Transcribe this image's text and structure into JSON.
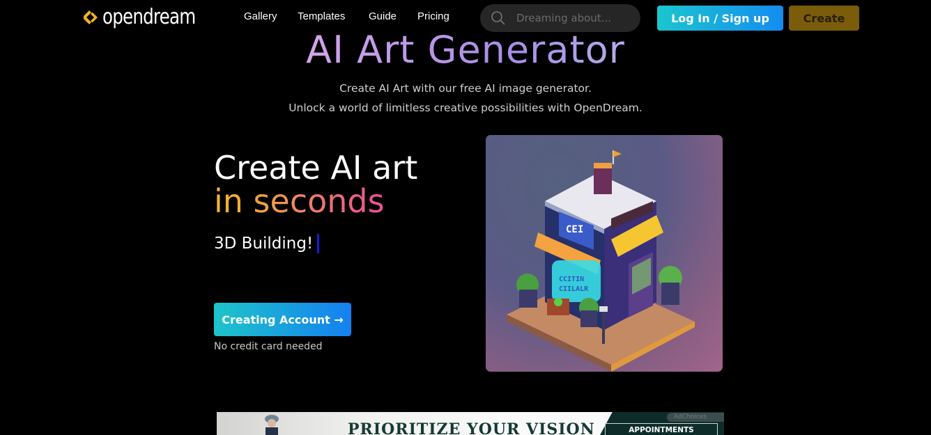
{
  "header": {
    "brand": "opendream",
    "nav": [
      {
        "label": "Gallery"
      },
      {
        "label": "Templates"
      },
      {
        "label": "Guide"
      },
      {
        "label": "Pricing"
      }
    ],
    "search": {
      "placeholder": "Dreaming about...",
      "value": "",
      "icon": "search-icon"
    },
    "login_label": "Log In / Sign up",
    "create_label": "Create"
  },
  "hero": {
    "title": "AI Art Generator",
    "subtitle_lines": [
      "Create AI Art with our free AI image generator.",
      "Unlock a world of limitless creative possibilities with OpenDream."
    ],
    "headline_line1": "Create AI art",
    "headline_line2": "in seconds",
    "typed_text": "3D Building!",
    "cta_label": "Creating Account →",
    "cta_note": "No credit card needed",
    "image_subject": "Isometric 3D storefront building"
  },
  "ad": {
    "headline": "PRIORITIZE YOUR VISION",
    "cta": "APPOINTMENTS AVAILABLE",
    "adchoices": "AdChoices"
  },
  "colors": {
    "background": "#000000",
    "login_gradient": [
      "#1bc6cf",
      "#148cf0"
    ],
    "create_button": "#7a5c0a",
    "brand_accent": "#f5b320",
    "caret": "#1a1ad8"
  }
}
